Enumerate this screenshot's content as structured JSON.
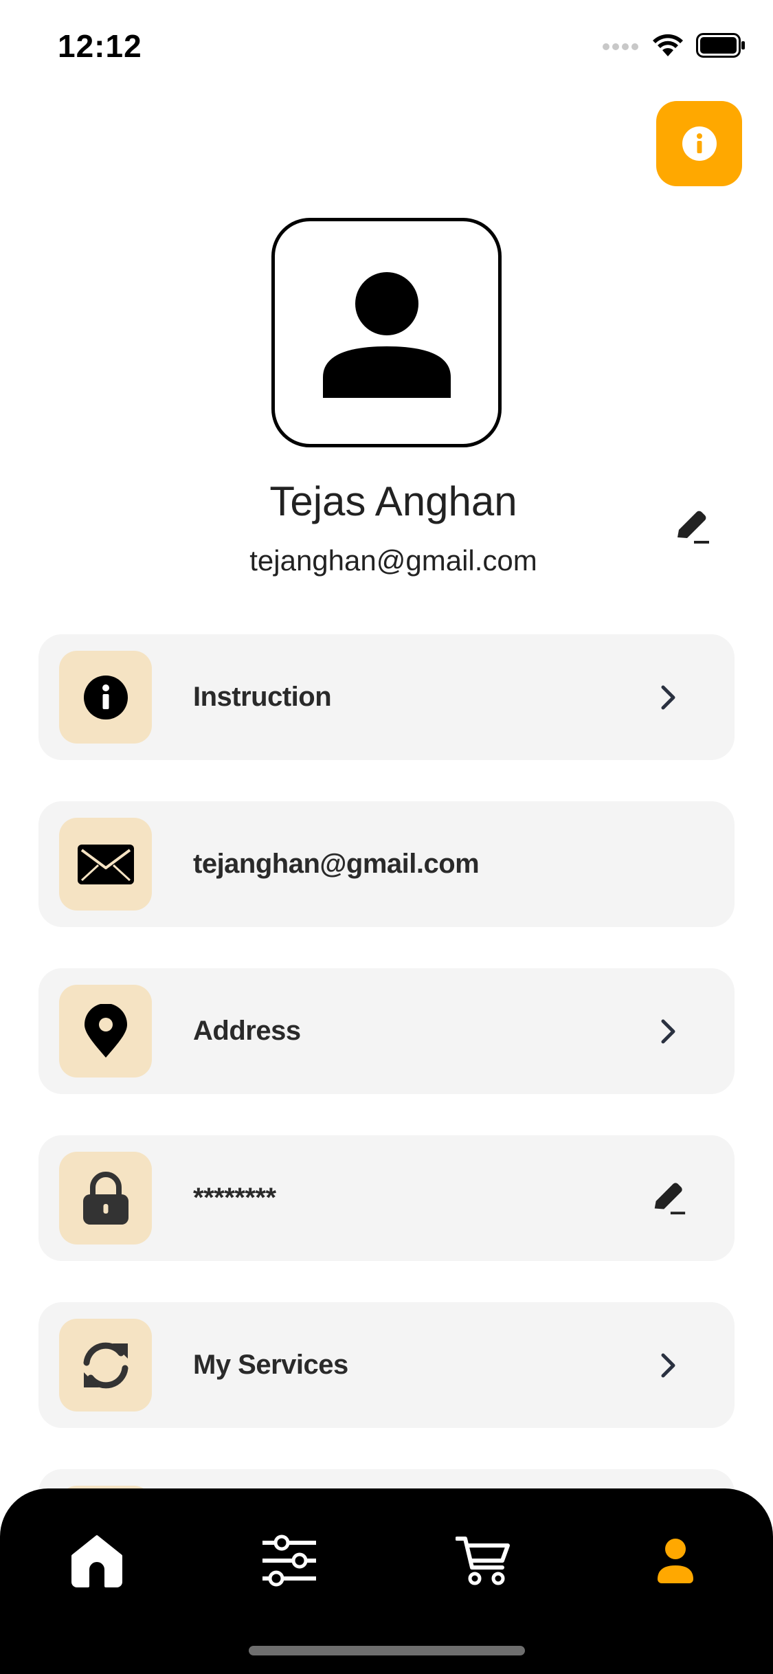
{
  "status_bar": {
    "time": "12:12"
  },
  "profile": {
    "name": "Tejas Anghan",
    "email": "tejanghan@gmail.com"
  },
  "menu": [
    {
      "label": "Instruction",
      "icon": "info-icon",
      "trailing": "chevron-right-icon"
    },
    {
      "label": "tejanghan@gmail.com",
      "icon": "envelope-icon",
      "trailing": ""
    },
    {
      "label": "Address",
      "icon": "location-pin-icon",
      "trailing": "chevron-right-icon"
    },
    {
      "label": "********",
      "icon": "lock-icon",
      "trailing": "edit-icon"
    },
    {
      "label": "My Services",
      "icon": "refresh-icon",
      "trailing": "chevron-right-icon"
    }
  ],
  "tab_bar": {
    "tabs": [
      "home-icon",
      "sliders-icon",
      "cart-icon",
      "user-icon"
    ],
    "active": "user-icon"
  },
  "colors": {
    "accent": "#ffa800",
    "icon_box": "#f5e3c3",
    "card": "#f4f4f4",
    "tab_bar": "#000000"
  }
}
